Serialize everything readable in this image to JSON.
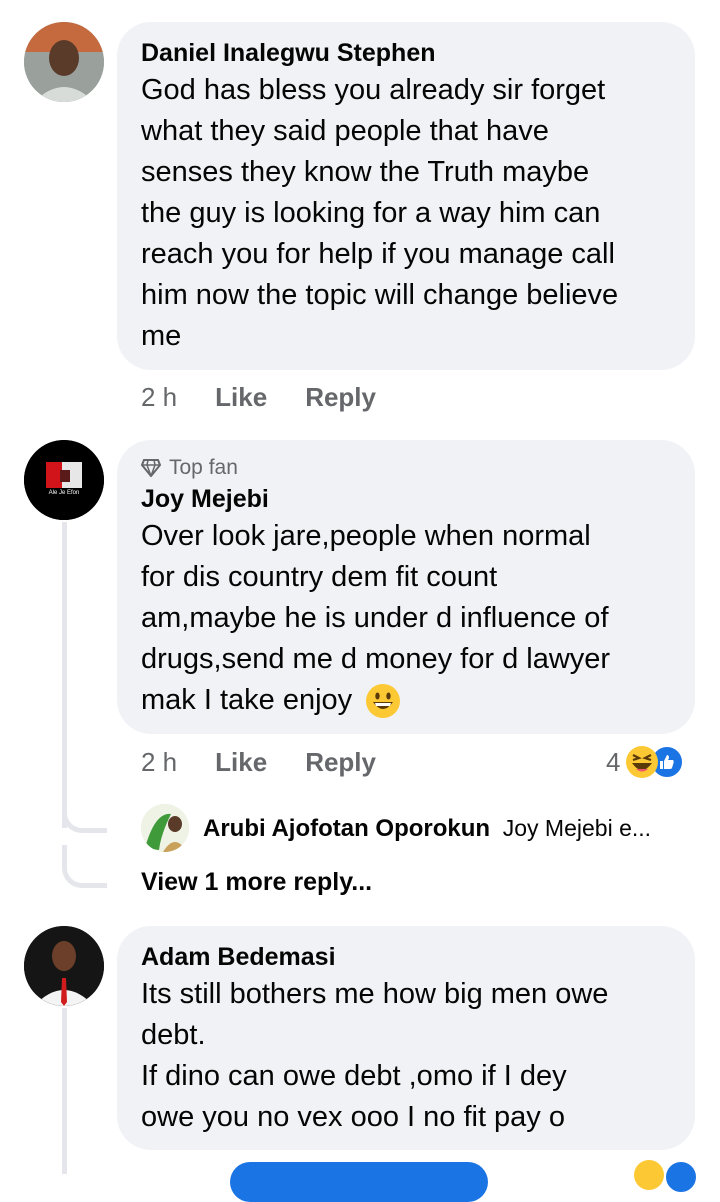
{
  "comments": [
    {
      "author": "Daniel Inalegwu Stephen",
      "lines": [
        "God has bless you already sir forget",
        "what they said people that have",
        "senses they know the Truth maybe",
        "the guy is looking for a way him can",
        "reach you for help if you manage call",
        "him now the topic will change believe",
        "me"
      ],
      "time": "2 h",
      "like_label": "Like",
      "reply_label": "Reply"
    },
    {
      "badge": "Top fan",
      "author": "Joy Mejebi",
      "lines": [
        "Over look jare,people when normal",
        "for dis country dem fit count",
        "am,maybe he is under d influence of",
        "drugs,send me d money for d lawyer",
        "mak I take enjoy"
      ],
      "time": "2 h",
      "like_label": "Like",
      "reply_label": "Reply",
      "reaction_count": "4",
      "avatar_text": "Ale Je Efon",
      "reply_preview": {
        "author": "Arubi Ajofotan Oporokun",
        "snippet": "Joy Mejebi e..."
      },
      "view_more": "View 1 more reply..."
    },
    {
      "author": "Adam Bedemasi",
      "lines": [
        "Its still bothers me how big men owe",
        "debt.",
        "If dino can owe debt ,omo if I dey",
        "owe you no vex ooo I no fit pay o"
      ]
    }
  ],
  "colors": {
    "bubble": "#f0f2f5",
    "meta": "#65676b",
    "text": "#050505",
    "thread": "#e4e6eb",
    "like_blue": "#1b74e4",
    "emoji_yellow": "#fcc934"
  },
  "icons": [
    "diamond-icon",
    "laughing-emoji-icon",
    "like-reaction-icon",
    "grinning-emoji-icon"
  ]
}
